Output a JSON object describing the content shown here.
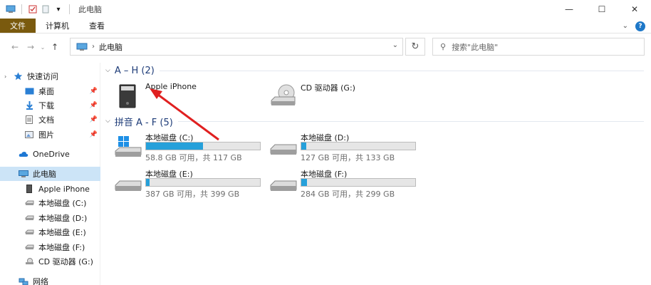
{
  "window": {
    "title": "此电脑"
  },
  "ribbon": {
    "tabs": [
      "文件",
      "计算机",
      "查看"
    ]
  },
  "address": {
    "path": "此电脑",
    "search_placeholder": "搜索\"此电脑\""
  },
  "sidebar": {
    "quick_access": "快速访问",
    "items": [
      {
        "label": "桌面",
        "pinned": true
      },
      {
        "label": "下载",
        "pinned": true
      },
      {
        "label": "文档",
        "pinned": true
      },
      {
        "label": "图片",
        "pinned": true
      }
    ],
    "onedrive": "OneDrive",
    "this_pc": "此电脑",
    "pc_children": [
      {
        "label": "Apple iPhone"
      },
      {
        "label": "本地磁盘 (C:)"
      },
      {
        "label": "本地磁盘 (D:)"
      },
      {
        "label": "本地磁盘 (E:)"
      },
      {
        "label": "本地磁盘 (F:)"
      },
      {
        "label": "CD 驱动器 (G:)"
      }
    ],
    "network": "网络"
  },
  "groups": [
    {
      "title": "A – H (2)",
      "items": [
        {
          "name": "Apple iPhone"
        },
        {
          "name": "CD 驱动器 (G:)"
        }
      ]
    },
    {
      "title": "拼音 A - F (5)",
      "drives": [
        {
          "name": "本地磁盘 (C:)",
          "size": "58.8 GB 可用，共 117 GB",
          "used_fraction": 0.5
        },
        {
          "name": "本地磁盘 (D:)",
          "size": "127 GB 可用，共 133 GB",
          "used_fraction": 0.045
        },
        {
          "name": "本地磁盘 (E:)",
          "size": "387 GB 可用，共 399 GB",
          "used_fraction": 0.03
        },
        {
          "name": "本地磁盘 (F:)",
          "size": "284 GB 可用，共 299 GB",
          "used_fraction": 0.05
        }
      ]
    }
  ],
  "colors": {
    "file_tab": "#7a5a0e",
    "selection": "#cce4f7",
    "group_header": "#1e3c78",
    "drive_fill": "#26a0da",
    "annotation_arrow": "#e02020"
  }
}
